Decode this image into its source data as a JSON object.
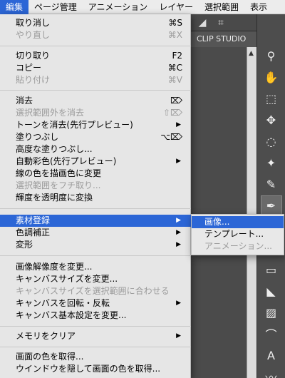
{
  "menubar": {
    "items": [
      "編集",
      "ページ管理",
      "アニメーション",
      "レイヤー",
      "選択範囲",
      "表示"
    ]
  },
  "app": {
    "title": "CLIP STUDIO"
  },
  "menu": {
    "items": [
      {
        "label": "取り消し",
        "shortcut": "⌘S"
      },
      {
        "label": "やり直し",
        "shortcut": "⌘X"
      },
      {
        "label": "切り取り",
        "shortcut": "F2"
      },
      {
        "label": "コピー",
        "shortcut": "⌘C"
      },
      {
        "label": "貼り付け",
        "shortcut": "⌘V"
      },
      {
        "label": "消去",
        "shortcut": "⌦"
      },
      {
        "label": "選択範囲外を消去",
        "shortcut": "⇧⌦"
      },
      {
        "label": "トーンを消去(先行プレビュー)",
        "shortcut": "▶"
      },
      {
        "label": "塗りつぶし",
        "shortcut": "⌥⌦"
      },
      {
        "label": "高度な塗りつぶし...",
        "shortcut": ""
      },
      {
        "label": "自動彩色(先行プレビュー)",
        "shortcut": "▶"
      },
      {
        "label": "線の色を描画色に変更",
        "shortcut": ""
      },
      {
        "label": "選択範囲をフチ取り...",
        "shortcut": ""
      },
      {
        "label": "輝度を透明度に変換",
        "shortcut": ""
      },
      {
        "label": "素材登録",
        "shortcut": "▶"
      },
      {
        "label": "色調補正",
        "shortcut": "▶"
      },
      {
        "label": "変形",
        "shortcut": "▶"
      },
      {
        "label": "画像解像度を変更...",
        "shortcut": ""
      },
      {
        "label": "キャンバスサイズを変更...",
        "shortcut": ""
      },
      {
        "label": "キャンバスサイズを選択範囲に合わせる",
        "shortcut": ""
      },
      {
        "label": "キャンバスを回転・反転",
        "shortcut": "▶"
      },
      {
        "label": "キャンバス基本設定を変更...",
        "shortcut": ""
      },
      {
        "label": "メモリをクリア",
        "shortcut": "▶"
      },
      {
        "label": "画面の色を取得...",
        "shortcut": ""
      },
      {
        "label": "ウインドウを隠して画面の色を取得...",
        "shortcut": ""
      }
    ]
  },
  "submenu": {
    "items": [
      {
        "label": "画像..."
      },
      {
        "label": "テンプレート..."
      },
      {
        "label": "アニメーション..."
      }
    ]
  },
  "sidebar": {
    "tools": [
      "zoom-icon",
      "hand-icon",
      "object-icon",
      "operation-icon",
      "lasso-icon",
      "wand-icon",
      "eyedropper-icon",
      "pen-icon",
      "brush-icon",
      "airbrush-icon",
      "eraser-icon",
      "fill-icon",
      "gradient-icon",
      "figure-icon",
      "text-icon",
      "vector-icon"
    ]
  }
}
